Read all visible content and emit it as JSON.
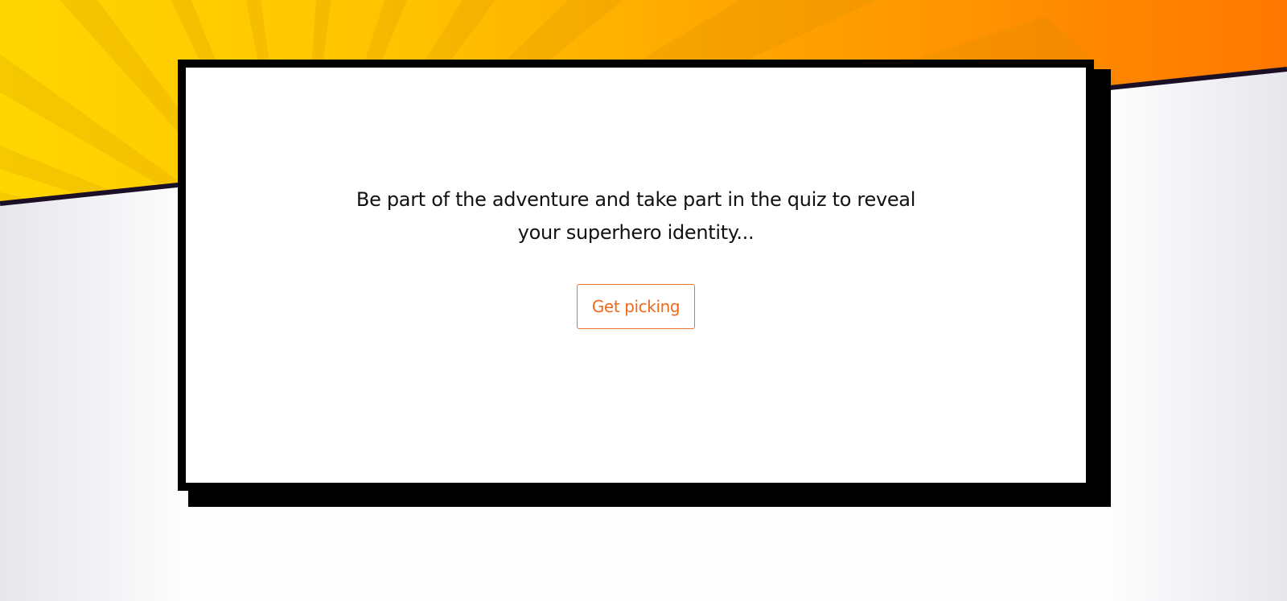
{
  "hero": {
    "colors": {
      "yellow": "#ffd400",
      "orange": "#ff7a00",
      "edge": "#1a0f24"
    }
  },
  "quiz_card": {
    "intro_text": "Be part of the adventure and take part in the quiz to reveal your superhero identity...",
    "button_label": "Get picking",
    "button_color": "#ee6a1a"
  }
}
